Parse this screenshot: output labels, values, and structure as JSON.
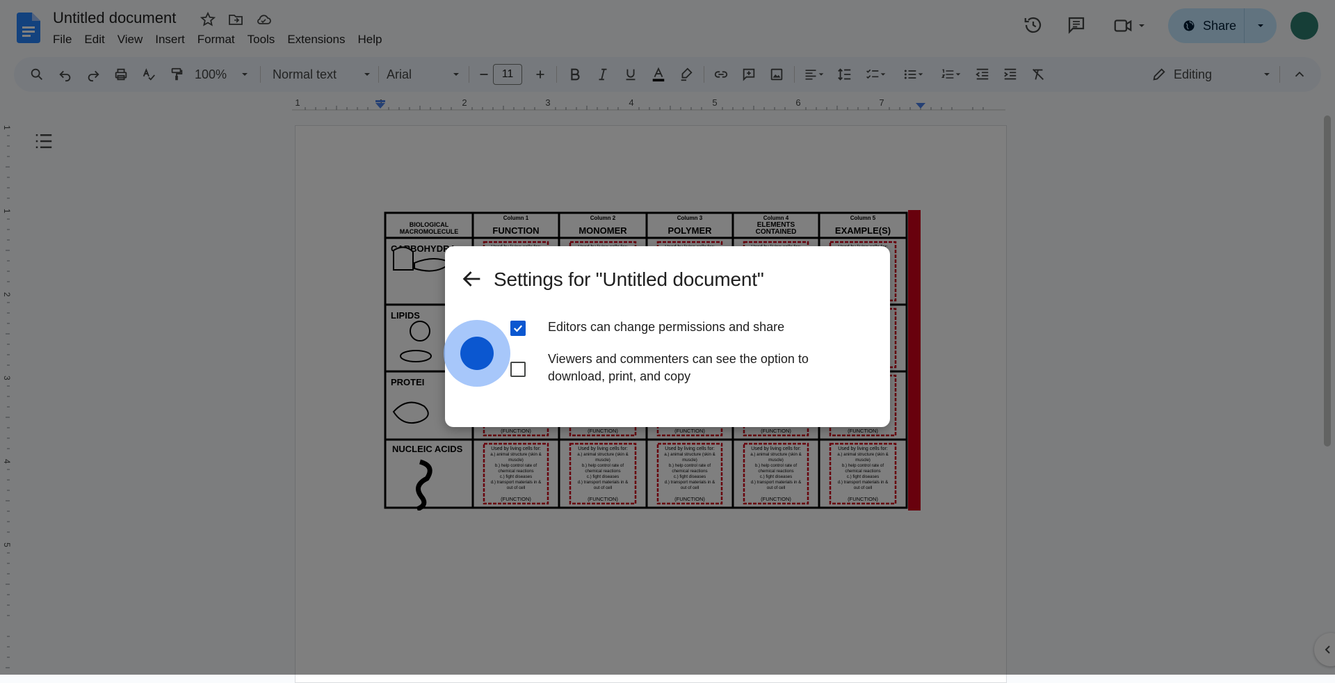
{
  "app": {
    "document_title": "Untitled document",
    "menu": [
      "File",
      "Edit",
      "View",
      "Insert",
      "Format",
      "Tools",
      "Extensions",
      "Help"
    ]
  },
  "header": {
    "share_label": "Share"
  },
  "toolbar": {
    "zoom": "100%",
    "style": "Normal text",
    "font": "Arial",
    "font_size": "11",
    "mode": "Editing"
  },
  "ruler": {
    "ticks": [
      "1",
      "1",
      "2",
      "3",
      "4",
      "5",
      "6",
      "7"
    ]
  },
  "worksheet": {
    "headers": [
      {
        "top": "",
        "main": "BIOLOGICAL MACROMOLECULE"
      },
      {
        "top": "Column 1",
        "main": "FUNCTION"
      },
      {
        "top": "Column 2",
        "main": "MONOMER"
      },
      {
        "top": "Column 3",
        "main": "POLYMER"
      },
      {
        "top": "Column 4",
        "main": "ELEMENTS CONTAINED"
      },
      {
        "top": "Column 5",
        "main": "EXAMPLE(S)"
      }
    ],
    "rows": [
      "CARBOHYDRA",
      "LIPIDS",
      "PROTEI",
      "NUCLEIC ACIDS"
    ],
    "card_title": "Used by living cells for:",
    "card_lines": [
      "a.) animal structure (skin &",
      "muscle)",
      "b.) help control rate of",
      "chemical reactions",
      "c.) fight diseases",
      "d.) transport materials in &",
      "out of cell"
    ],
    "card_footer": "(FUNCTION)"
  },
  "dialog": {
    "title": "Settings for \"Untitled document\"",
    "option1": {
      "label": "Editors can change permissions and share",
      "checked": true
    },
    "option2": {
      "label_line1": "Viewers and commenters can see the option to",
      "label_line2": "download, print, and copy",
      "checked": false
    }
  },
  "colors": {
    "accent": "#0b57d0",
    "share_bg": "#c2e7ff",
    "toolbar_bg": "#edf2fa",
    "worksheet_red": "#d0021b"
  },
  "icons": [
    "docs-logo-icon",
    "star-icon",
    "move-folder-icon",
    "cloud-status-icon",
    "history-icon",
    "comments-icon",
    "video-call-icon",
    "globe-icon",
    "search-icon",
    "undo-icon",
    "redo-icon",
    "print-icon",
    "spellcheck-icon",
    "paint-format-icon",
    "bold-icon",
    "italic-icon",
    "underline-icon",
    "text-color-icon",
    "highlight-icon",
    "link-icon",
    "add-comment-icon",
    "image-icon",
    "align-icon",
    "line-spacing-icon",
    "checklist-icon",
    "bullet-list-icon",
    "numbered-list-icon",
    "decrease-indent-icon",
    "increase-indent-icon",
    "clear-format-icon",
    "pencil-icon",
    "collapse-icon",
    "outline-icon",
    "back-arrow-icon"
  ]
}
